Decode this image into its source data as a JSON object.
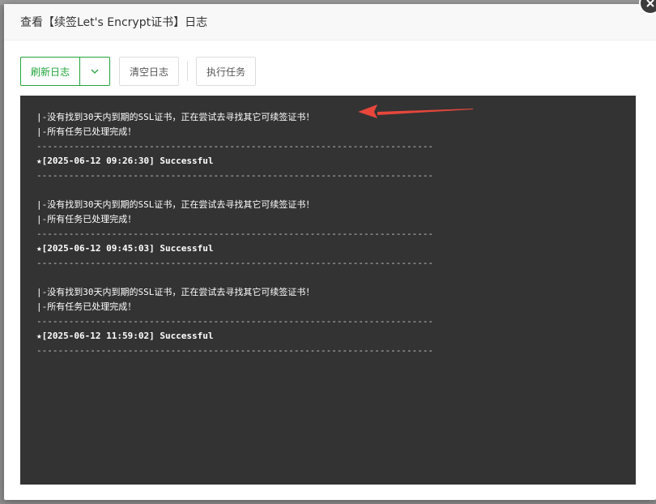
{
  "dialog": {
    "title": "查看【续签Let's Encrypt证书】日志",
    "close_icon": "close-icon"
  },
  "toolbar": {
    "refresh_label": "刷新日志",
    "refresh_dropdown_icon": "chevron-down-icon",
    "clear_label": "清空日志",
    "exec_label": "执行任务"
  },
  "colors": {
    "accent": "#20a53a",
    "log_background": "#333333",
    "arrow": "#e8463b"
  },
  "log": {
    "lines": [
      "|-没有找到30天内到期的SSL证书，正在尝试去寻找其它可续签证书！",
      "|-所有任务已处理完成！",
      "--------------------------------------------------------------------------",
      "★[2025-06-12 09:26:30] Successful",
      "--------------------------------------------------------------------------",
      "",
      "|-没有找到30天内到期的SSL证书，正在尝试去寻找其它可续签证书！",
      "|-所有任务已处理完成！",
      "--------------------------------------------------------------------------",
      "★[2025-06-12 09:45:03] Successful",
      "--------------------------------------------------------------------------",
      "",
      "|-没有找到30天内到期的SSL证书，正在尝试去寻找其它可续签证书！",
      "|-所有任务已处理完成！",
      "--------------------------------------------------------------------------",
      "★[2025-06-12 11:59:02] Successful",
      "--------------------------------------------------------------------------"
    ]
  }
}
